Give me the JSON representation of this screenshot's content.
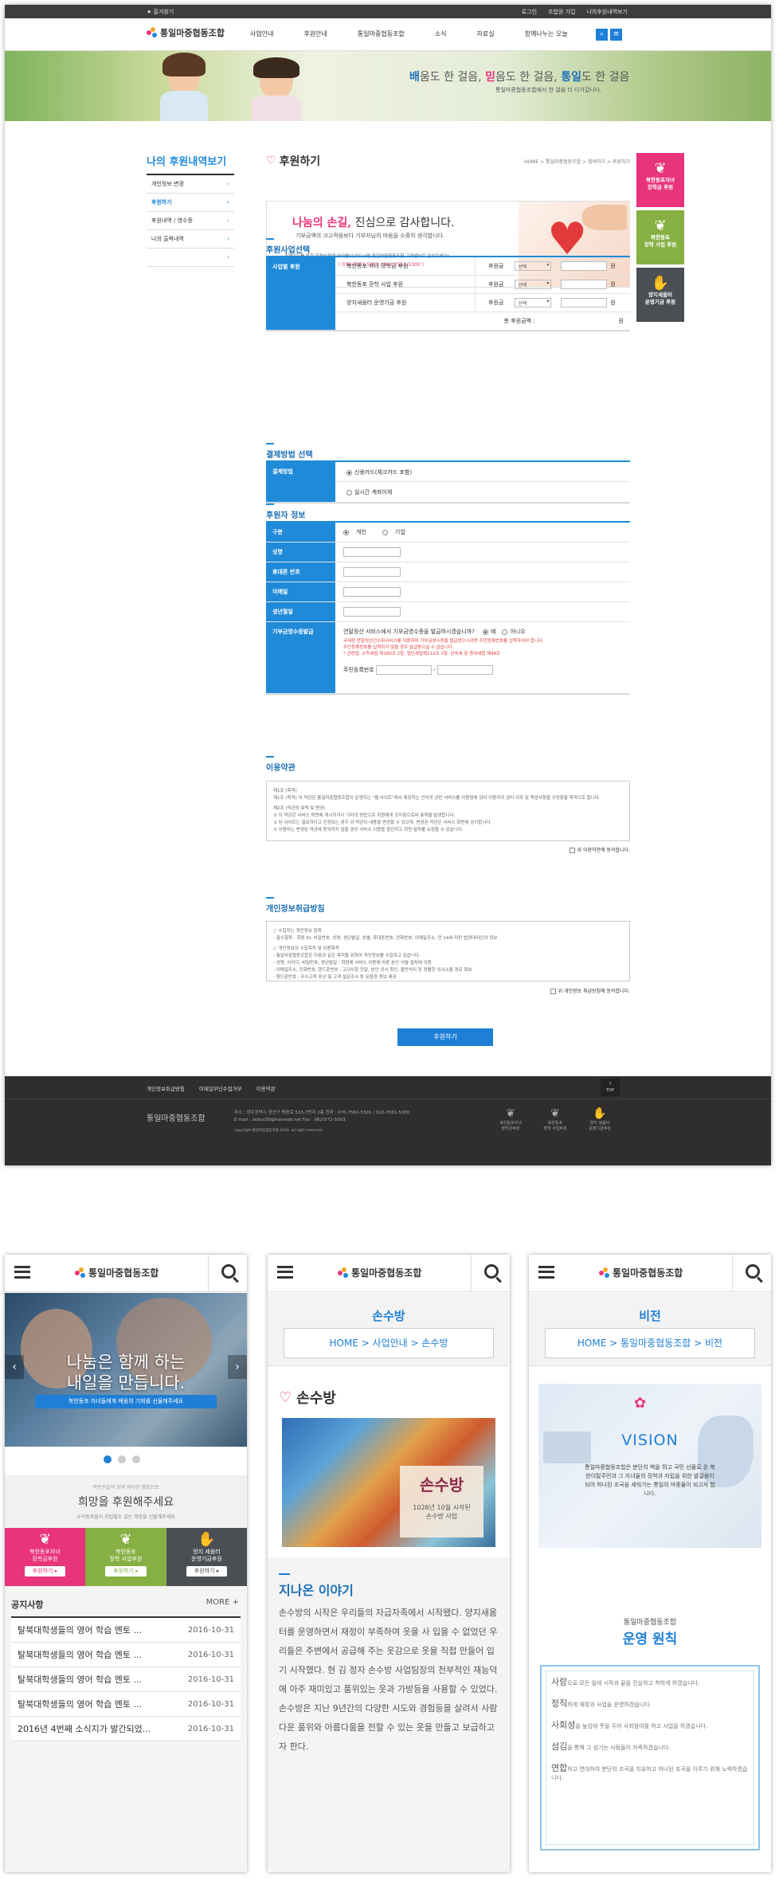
{
  "desktop": {
    "topbar": {
      "favorite": "★ 즐겨찾기",
      "links": [
        "로그인",
        "조합원 가입",
        "나의후원내역보기"
      ]
    },
    "logo": "통일마중협동조합",
    "menu": [
      "사업안내",
      "후원안내",
      "통일마중협동조합",
      "소식",
      "자료실",
      "함께나누는 오늘"
    ],
    "banner": {
      "headline_a": "배",
      "headline_b": "움도 한 걸음, ",
      "headline_c": "믿",
      "headline_d": "음도 한 걸음, ",
      "headline_e": "통일",
      "headline_f": "도 한 걸음",
      "sub": "통일마중협동조합에서 한 걸음 더 다가갑니다."
    },
    "lnb": {
      "title": "나의 후원내역보기",
      "items": [
        "개인정보 변경",
        "후원하기",
        "후원내역 / 영수증",
        "나의 출력내역",
        ""
      ]
    },
    "page_title": "후원하기",
    "breadcrumb": "HOME > 통일마중협동조합 > 참여하기 > 후원하기",
    "thanks": {
      "t1": "나눔의 손길,",
      "t2": " 진심으로 감사합니다.",
      "l1": "기부금액의 크고적음보다 기부자님의 마음을 소중히 생각합니다.",
      "l2": "홈페이지를 통한 후원신청에 어려움이 있으시면 통일마중협동조합 고객센터로 문의주세요!",
      "phone": "( 070-7561-5301 / 010-7551-5300 )"
    },
    "sec1": {
      "title": "후원사업선택",
      "label": "사업별 후원",
      "rows": [
        "북한동포 자녀 장학금 후원",
        "북한동포 장학 사업 후원",
        "양지새움터 운영기금 후원"
      ],
      "amount_label": "후원금",
      "select": "선택",
      "unit": "원",
      "total": "총 후원금액 :",
      "total_unit": "원"
    },
    "sec2": {
      "title": "결제방법 선택",
      "label": "결제방법",
      "opt1": "신용카드(체크카드 포함)",
      "opt2": "실시간 계좌이체"
    },
    "sec3": {
      "title": "후원자 정보",
      "rows": [
        "구분",
        "성명",
        "휴대폰 번호",
        "이메일",
        "생년월일",
        "기부금영수증발급"
      ],
      "type1": "개인",
      "type2": "기업",
      "receipt_q": "연말정산 서비스에서 기부금영수증을 발급하시겠습니까?",
      "yes": "예",
      "no": "아니오",
      "note1": "국세청 연말정산간소화서비스를 이용하여 기부금영수증을 발급받으시려면 주민등록번호를 입력하셔야 합니다.",
      "note2": "주민등록번호를 입력하지 않을 경우 발급받으실 수 없습니다.",
      "note3": "* 관련법: 소득세법 제160조 2항, 법인세법제112조 2항, 상속세 및 증여세법 제48조",
      "jumin": "주민등록번호",
      "dash": "-"
    },
    "sec4": {
      "title": "이용약관",
      "lines": [
        "제1조 (목적)",
        "제1조 (목적) 이 약관은 통일마중협동조합이 운영하는 \"웹 사이트\"에서 제공하는 인터넷 관련 서비스를 이용함에 있어 이용자의 권리·의무 및 책임사항을 규정함을 목적으로 합니다.",
        "제2조 (약관의 효력 및 변경)",
        "① 이 약관은 서비스 화면에 게시하거나 기타의 방법으로 회원에게 공지함으로써 효력을 발생합니다.",
        "② 당 사이트는 필요하다고 인정되는 경우 이 약관의 내용을 변경할 수 있으며, 변경된 약관은 서비스 화면에 공지합니다.",
        "③ 이용자는 변경된 약관에 동의하지 않을 경우 서비스 이용을 중단하고 회원 탈퇴를 요청할 수 있습니다."
      ],
      "agree": "위 이용약관에 동의합니다."
    },
    "sec5": {
      "title": "개인정보취급방침",
      "lines": [
        "○ 수집하는 개인정보 항목",
        "- 필수항목 : 회원 ID, 비밀번호, 성명, 생년월일, 성별, 휴대폰번호, 전화번호, 이메일주소, 만 14세 미만 법정대리인의 정보",
        "○ 개인정보의 수집목적 및 이용목적",
        "- 통일마중협동조합은 다음과 같은 목적을 위하여 개인정보를 수집하고 있습니다.",
        "- 성명, 아이디, 비밀번호, 생년월일 : 회원제 서비스 이용에 따른 본인 식별 절차에 이용",
        "- 이메일주소, 전화번호, 핸드폰번호 : 고지사항 전달, 본인 의사 확인, 불만처리 등 원활한 의사소통 경로 확보",
        "- 핸드폰번호 : 우수고객 포상 및 고객 설문조사 등 유용한 정보 제공"
      ],
      "agree": "위 개인정보 취급방침에 동의합니다."
    },
    "submit": "후원하기",
    "quick": [
      {
        "l1": "북한동포자녀",
        "l2": "장학금 후원"
      },
      {
        "l1": "북한동포",
        "l2": "장학 사업 후원"
      },
      {
        "l1": "양지새움터",
        "l2": "운영기금 후원"
      }
    ],
    "footer": {
      "links": [
        "개인정보취급방침",
        "이메일무단수집거부",
        "이용약관"
      ],
      "top": "TOP",
      "logo": "통일마중협동조합",
      "addr": "주소 : 광주광역시 광산구 평동로 533-7번지 2층   전화 : 070-7561-5301 / 010-7551-5300",
      "mail": "E-mail : oldsol30@hanmail.net    Fax : 062)572-5003",
      "copy": "copyright 통일마중협동조합 2016. all right reserved.",
      "icons": [
        {
          "l1": "북한동포자녀",
          "l2": "장학금후원"
        },
        {
          "l1": "북한동포",
          "l2": "장학 사업후원"
        },
        {
          "l1": "양지 세움터",
          "l2": "운영기금후원"
        }
      ]
    }
  },
  "mobile1": {
    "logo": "통일마중협동조합",
    "hero1": "나눔은 함께 하는",
    "hero2": "내일을 만듭니다.",
    "hero_btn": "북한동포 자녀들에게 배움의 기회를 선물해주세요",
    "promo_small": "작은손길이 모여 커다란 희망으로",
    "promo_title": "희망을 후원해주세요",
    "promo_sub": "우리동포들이 자립할수 있는 희망을 선물해주세요",
    "cards": [
      {
        "l1": "북한동포자녀",
        "l2": "장학금후원",
        "btn": "후원하기 ▸",
        "color": "#e8347b"
      },
      {
        "l1": "북한동포",
        "l2": "장학 사업후원",
        "btn": "후원하기 ▸",
        "color": "#86b043"
      },
      {
        "l1": "양지 세움터",
        "l2": "운영기금후원",
        "btn": "후원하기 ▸",
        "color": "#4a4f54"
      }
    ],
    "notice_title": "공지사항",
    "more": "MORE +",
    "notices": [
      {
        "t": "탈북대학생들의 영어 학습 멘토 ...",
        "d": "2016-10-31"
      },
      {
        "t": "탈북대학생들의 영어 학습 멘토 ...",
        "d": "2016-10-31"
      },
      {
        "t": "탈북대학생들의 영어 학습 멘토 ...",
        "d": "2016-10-31"
      },
      {
        "t": "탈북대학생들의 영어 학습 멘토 ...",
        "d": "2016-10-31"
      },
      {
        "t": "2016년 4번째 소식지가 발간되었...",
        "d": "2016-10-31"
      }
    ]
  },
  "mobile2": {
    "logo": "통일마중협동조합",
    "title": "손수방",
    "crumb": "HOME > 사업안내 > 손수방",
    "heading": "손수방",
    "img_label": "손수방",
    "img_sub1": "1026년 10월 시작된",
    "img_sub2": "손수방 사업",
    "story_title": "지나온 이야기",
    "story": "손수방의 시작은 우리들의 자급자족에서 시작됐다. 양지새움터를 운영하면서 재정이 부족하여 옷을 사 입을 수 없었던 우리들은 주변에서 공급해 주는 옷감으로 옷을 직접 만들어 입기 시작했다. 현 김 정자 손수방 사업팀장의 천부적인 재능덕에 아주 재미있고 품위있는 옷과 가방등을 사용할 수 있었다. 손수방은 지난 9년간의 다양한 시도와 경험등을 살려서 사람다운 품위와 아름다움을 전할 수 있는 옷을 만들고 보급하고자 한다."
  },
  "mobile3": {
    "logo": "통일마중협동조합",
    "title": "비전",
    "crumb": "HOME > 통일마중협동조합 > 비전",
    "vision": "VISION",
    "vision_text": "통일마중협동조합은 분단의 벽을 뛰고 국민 선물로 온 북한이탈주민과 그 자녀들의 정착과 자립을 위한 발걸음이 되어 하나된 조국을 세워가는 통일의 마중물이 되고자 합니다.",
    "org": "통일마중협동조합",
    "principle": "운영 원칙",
    "items": [
      {
        "k": "사랑",
        "v": "으로 모든 일에 시작과 끝을 진실하고 착하게 하겠습니다."
      },
      {
        "k": "정직",
        "v": "하게 재정과 사업을 운영하겠습니다."
      },
      {
        "k": "사회성",
        "v": "을 높임에 뜻을 두어 사회참여를 하고 사업을 하겠습니다."
      },
      {
        "k": "섬김",
        "v": "을 통해 그 섬기는 사람들이 자족하겠습니다."
      },
      {
        "k": "연합",
        "v": "하고 연대하여 분단의 조국을 치유하고 하나된 조국을 이루기 위해 노력하겠습니다."
      }
    ]
  }
}
